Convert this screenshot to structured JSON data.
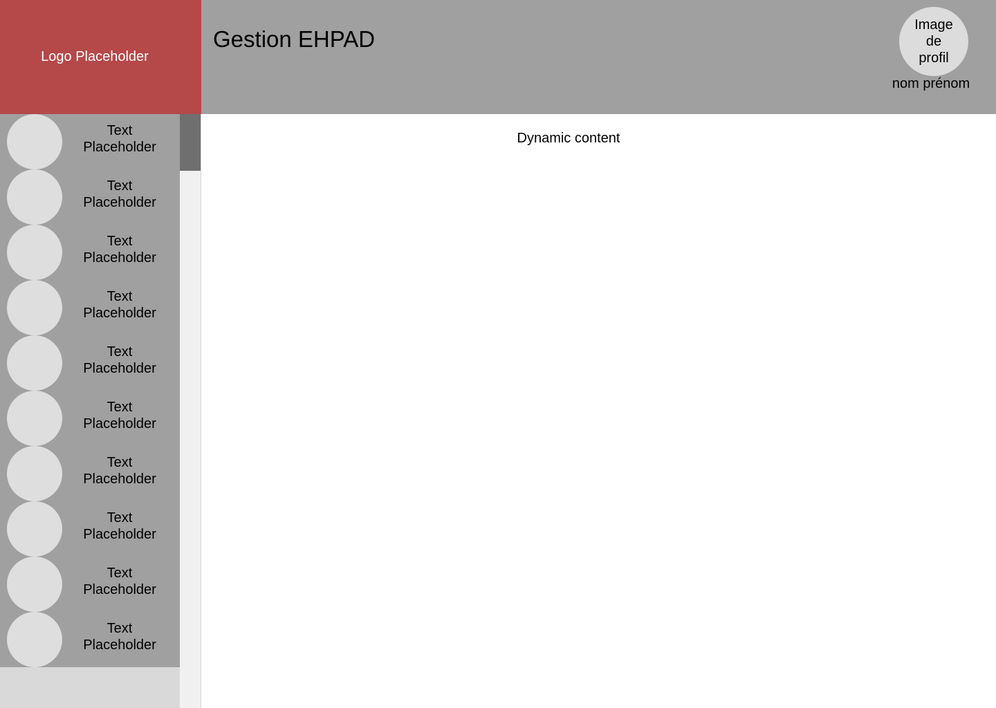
{
  "logo": {
    "text": "Logo Placeholder"
  },
  "header": {
    "title": "Gestion EHPAD",
    "profile": {
      "image_text": "Image de profil",
      "name": "nom prénom"
    }
  },
  "sidebar": {
    "items": [
      {
        "label": "Text Placeholder"
      },
      {
        "label": "Text Placeholder"
      },
      {
        "label": "Text Placeholder"
      },
      {
        "label": "Text Placeholder"
      },
      {
        "label": "Text Placeholder"
      },
      {
        "label": "Text Placeholder"
      },
      {
        "label": "Text Placeholder"
      },
      {
        "label": "Text Placeholder"
      },
      {
        "label": "Text Placeholder"
      },
      {
        "label": "Text Placeholder"
      }
    ]
  },
  "main": {
    "content": "Dynamic content"
  },
  "colors": {
    "logo_background": "#b54849",
    "header_background": "#a0a0a0",
    "placeholder_circle": "#dedede",
    "scrollbar_thumb": "#6f6f6f"
  }
}
